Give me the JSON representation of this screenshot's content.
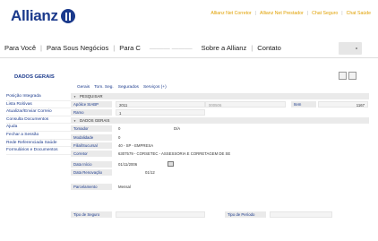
{
  "header": {
    "logo_text": "Allianz",
    "top_links": [
      "Allianz Net Corretor",
      "Allianz Net Prestador",
      "Chat Seguro",
      "Chat Saúde"
    ]
  },
  "nav": {
    "items": [
      "Para Você",
      "Para Sous Negócios",
      "Para C",
      "Sobre a Allianz",
      "Contato"
    ]
  },
  "page": {
    "title": "DADOS GERAIS",
    "subtabs": [
      "Gerais",
      "Tom. Seg.",
      "Segurados",
      "Serviços (+)"
    ]
  },
  "sidebar": {
    "items": [
      "Posição Integrada",
      "Lista Rolóvas",
      "Atualizar/Enviar Correio",
      "Consulta Documentos",
      "Ajuda",
      "Fechar a Sessão",
      "Rede Referenciada Saúde",
      "Formulários e Documentos"
    ]
  },
  "search": {
    "header": "PESQUISAR",
    "apolice_label": "Apólice SIABP",
    "apolice_value": "2011",
    "apolice_mid_value": "000506",
    "item_label": "Item",
    "item_value": "1167",
    "ramo_label": "Ramo",
    "ramo_value": "1"
  },
  "general": {
    "header": "DADOS GERAIS",
    "tomador_label": "Tomador",
    "tomador_value": "0",
    "tomador_type": "D/A",
    "modalidade_label": "Modalidade",
    "modalidade_value": "0",
    "filial_label": "Filial/Sucursal",
    "filial_value": "40 - SP - EMPRESA",
    "corretor_label": "Corretor",
    "corretor_value": "6307579 - CORSETEC - ASSESSORIA E CORRETAGEM DE SE",
    "data_inicio_label": "Data Início",
    "data_inicio_value": "01/11/2006",
    "data_renovacao_label": "Data Renovação",
    "data_renovacao_value": "01/12",
    "parcelamento_label": "Parcelamento",
    "parcelamento_value": "Mensal",
    "tipo_seguro_label": "Tipo de Seguro",
    "tipo_periodo_label": "Tipo de Período"
  }
}
